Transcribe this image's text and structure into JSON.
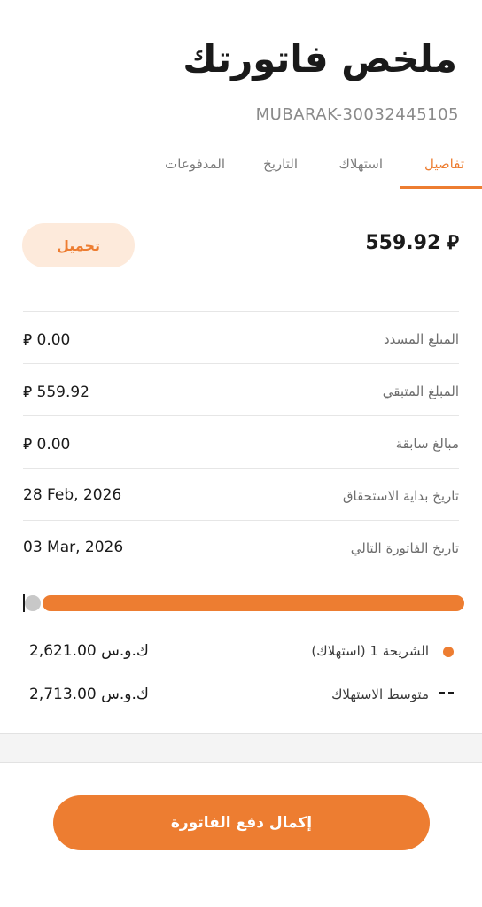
{
  "header": {
    "title": "ملخص فاتورتك",
    "account_number": "MUBARAK-30032445105"
  },
  "tabs": [
    {
      "label": "تفاصيل",
      "active": true
    },
    {
      "label": "استهلاك",
      "active": false
    },
    {
      "label": "التاريخ",
      "active": false
    },
    {
      "label": "المدفوعات",
      "active": false
    }
  ],
  "summary": {
    "amount": "559.92 ⃁",
    "download_label": "تحميل"
  },
  "rows": [
    {
      "label": "المبلغ المسدد",
      "value": "⃁ 0.00"
    },
    {
      "label": "المبلغ المتبقي",
      "value": "⃁ 559.92"
    },
    {
      "label": "مبالغ سابقة",
      "value": "⃁ 0.00"
    },
    {
      "label": "تاريخ بداية الاستحقاق",
      "value": "28 Feb, 2026"
    },
    {
      "label": "تاريخ الفاتورة التالي",
      "value": "03 Mar, 2026"
    }
  ],
  "consumption": {
    "progress_fraction": 1.0,
    "tier": {
      "label": "الشريحة 1 (استهلاك)",
      "value": "2,621.00 ك.و.س"
    },
    "average": {
      "label": "متوسط الاستهلاك",
      "value": "2,713.00 ك.و.س"
    }
  },
  "footer": {
    "pay_label": "إكمال دفع الفاتورة"
  },
  "colors": {
    "accent": "#ed7d31",
    "accent_light": "#fdeadb"
  }
}
